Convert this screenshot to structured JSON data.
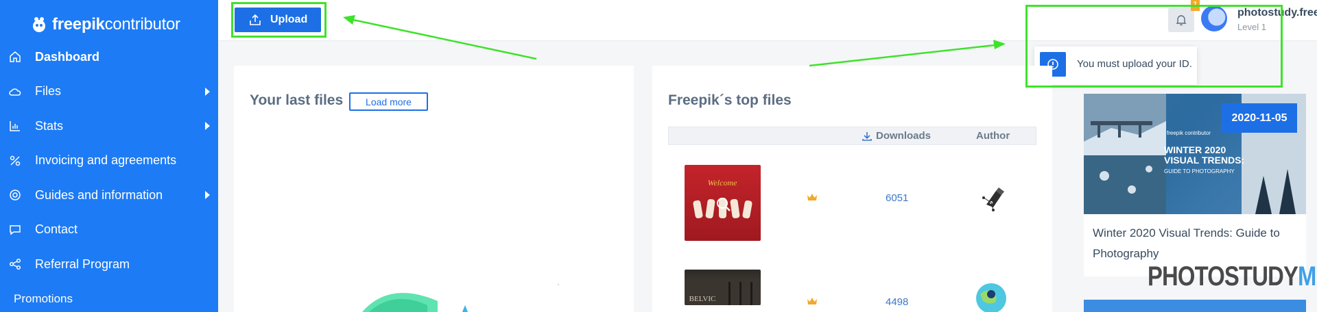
{
  "brand": {
    "bold": "freepik",
    "light": "contributor"
  },
  "sidebar": {
    "items": [
      {
        "label": "Dashboard",
        "icon": "home-icon",
        "active": true,
        "has_arrow": false
      },
      {
        "label": "Files",
        "icon": "cloud-icon",
        "active": false,
        "has_arrow": true
      },
      {
        "label": "Stats",
        "icon": "bar-chart-icon",
        "active": false,
        "has_arrow": true
      },
      {
        "label": "Invoicing and agreements",
        "icon": "percent-icon",
        "active": false,
        "has_arrow": false
      },
      {
        "label": "Guides and information",
        "icon": "lifebuoy-icon",
        "active": false,
        "has_arrow": true
      },
      {
        "label": "Contact",
        "icon": "chat-icon",
        "active": false,
        "has_arrow": false
      },
      {
        "label": "Referral Program",
        "icon": "share-icon",
        "active": false,
        "has_arrow": false
      }
    ],
    "promotions_label": "Promotions"
  },
  "topbar": {
    "upload_label": "Upload",
    "notification_count": "1",
    "user_name": "photostudy.freepik",
    "user_level": "Level 1"
  },
  "notification": {
    "message": "You must upload your ID."
  },
  "last_files": {
    "title": "Your last files",
    "load_more_label": "Load more"
  },
  "top_files": {
    "title": "Freepik´s top files",
    "columns": {
      "downloads": "Downloads",
      "author": "Author"
    },
    "rows": [
      {
        "downloads": "6051",
        "premium": true
      },
      {
        "downloads": "4498",
        "premium": true
      }
    ],
    "thumb1_text": "Welcome",
    "thumb2_text": "BELVIC"
  },
  "blog": {
    "date": "2020-11-05",
    "image_brand": "freepik contributor",
    "image_title_line1": "WINTER 2020",
    "image_title_line2": "VISUAL TRENDS:",
    "image_subtitle": "GUIDE TO PHOTOGRAPHY",
    "title": "Winter 2020 Visual Trends: Guide to Photography"
  },
  "watermark": {
    "part1": "PHOTOSTUDY",
    "part2": "ME"
  },
  "colors": {
    "sidebar": "#1d7bf5",
    "primary": "#1d6fe6",
    "annotation": "#3ee22b",
    "badge": "#f3a92a"
  }
}
